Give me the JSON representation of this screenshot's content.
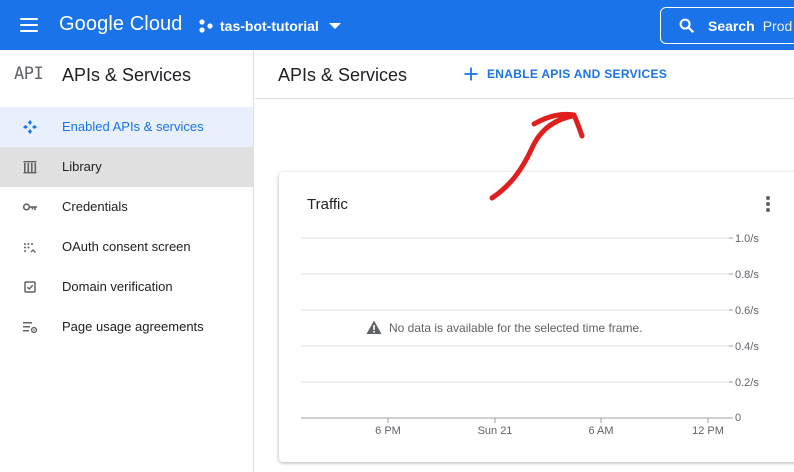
{
  "topbar": {
    "logo": "Google Cloud",
    "project_name": "tas-bot-tutorial",
    "search_label": "Search",
    "search_placeholder": "Prod",
    "icons": {
      "menu": "hamburger-menu-icon",
      "project": "project-hub-icon",
      "caret": "chevron-down-icon",
      "search": "search-icon"
    },
    "bg_color": "#1a73e8"
  },
  "sidebar": {
    "logo_text": "API",
    "title": "APIs & Services",
    "items": [
      {
        "label": "Enabled APIs & services",
        "icon": "api-diamond-icon",
        "state": "selected"
      },
      {
        "label": "Library",
        "icon": "library-icon",
        "state": "hover"
      },
      {
        "label": "Credentials",
        "icon": "key-icon",
        "state": "normal"
      },
      {
        "label": "OAuth consent screen",
        "icon": "consent-dots-icon",
        "state": "normal"
      },
      {
        "label": "Domain verification",
        "icon": "checkbox-icon",
        "state": "normal"
      },
      {
        "label": "Page usage agreements",
        "icon": "settings-list-icon",
        "state": "normal"
      }
    ]
  },
  "main": {
    "title": "APIs & Services",
    "enable_button": "ENABLE APIS AND SERVICES"
  },
  "traffic_card": {
    "title": "Traffic",
    "no_data_message": "No data is available for the selected time frame.",
    "y_ticks": [
      "1.0/s",
      "0.8/s",
      "0.6/s",
      "0.4/s",
      "0.2/s",
      "0"
    ],
    "x_ticks": [
      "6 PM",
      "Sun 21",
      "6 AM",
      "12 PM"
    ]
  },
  "annotation": {
    "type": "red-arrow",
    "color": "#e01e1e"
  }
}
